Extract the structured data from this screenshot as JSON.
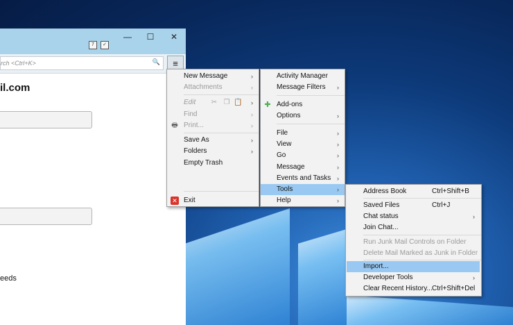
{
  "window": {
    "search_placeholder": "rch <Ctrl+K>",
    "account_title": "il.com",
    "feeds_label": "eeds",
    "icons": {
      "minimize": "—",
      "maximize": "☐",
      "close": "✕",
      "menu": "≡",
      "search": "🔍"
    }
  },
  "main_menu": {
    "new_message": "New Message",
    "attachments": "Attachments",
    "edit": "Edit",
    "find": "Find",
    "print": "Print...",
    "save_as": "Save As",
    "folders": "Folders",
    "empty_trash": "Empty Trash",
    "exit": "Exit"
  },
  "sub_menu": {
    "activity_manager": "Activity Manager",
    "message_filters": "Message Filters",
    "add_ons": "Add-ons",
    "options": "Options",
    "file": "File",
    "view": "View",
    "go": "Go",
    "message": "Message",
    "events_and_tasks": "Events and Tasks",
    "tools": "Tools",
    "help": "Help"
  },
  "tools_menu": {
    "address_book": "Address Book",
    "address_book_shortcut": "Ctrl+Shift+B",
    "saved_files": "Saved Files",
    "saved_files_shortcut": "Ctrl+J",
    "chat_status": "Chat status",
    "join_chat": "Join Chat...",
    "run_junk": "Run Junk Mail Controls on Folder",
    "delete_junk": "Delete Mail Marked as Junk in Folder",
    "import": "Import...",
    "developer_tools": "Developer Tools",
    "clear_history": "Clear Recent History...",
    "clear_history_shortcut": "Ctrl+Shift+Del"
  },
  "arrow_glyph": "›",
  "colors": {
    "highlight": "#99c9f2",
    "titlebar": "#a9d3ea",
    "exit_icon": "#d9342b",
    "addons_icon": "#4caf50"
  }
}
